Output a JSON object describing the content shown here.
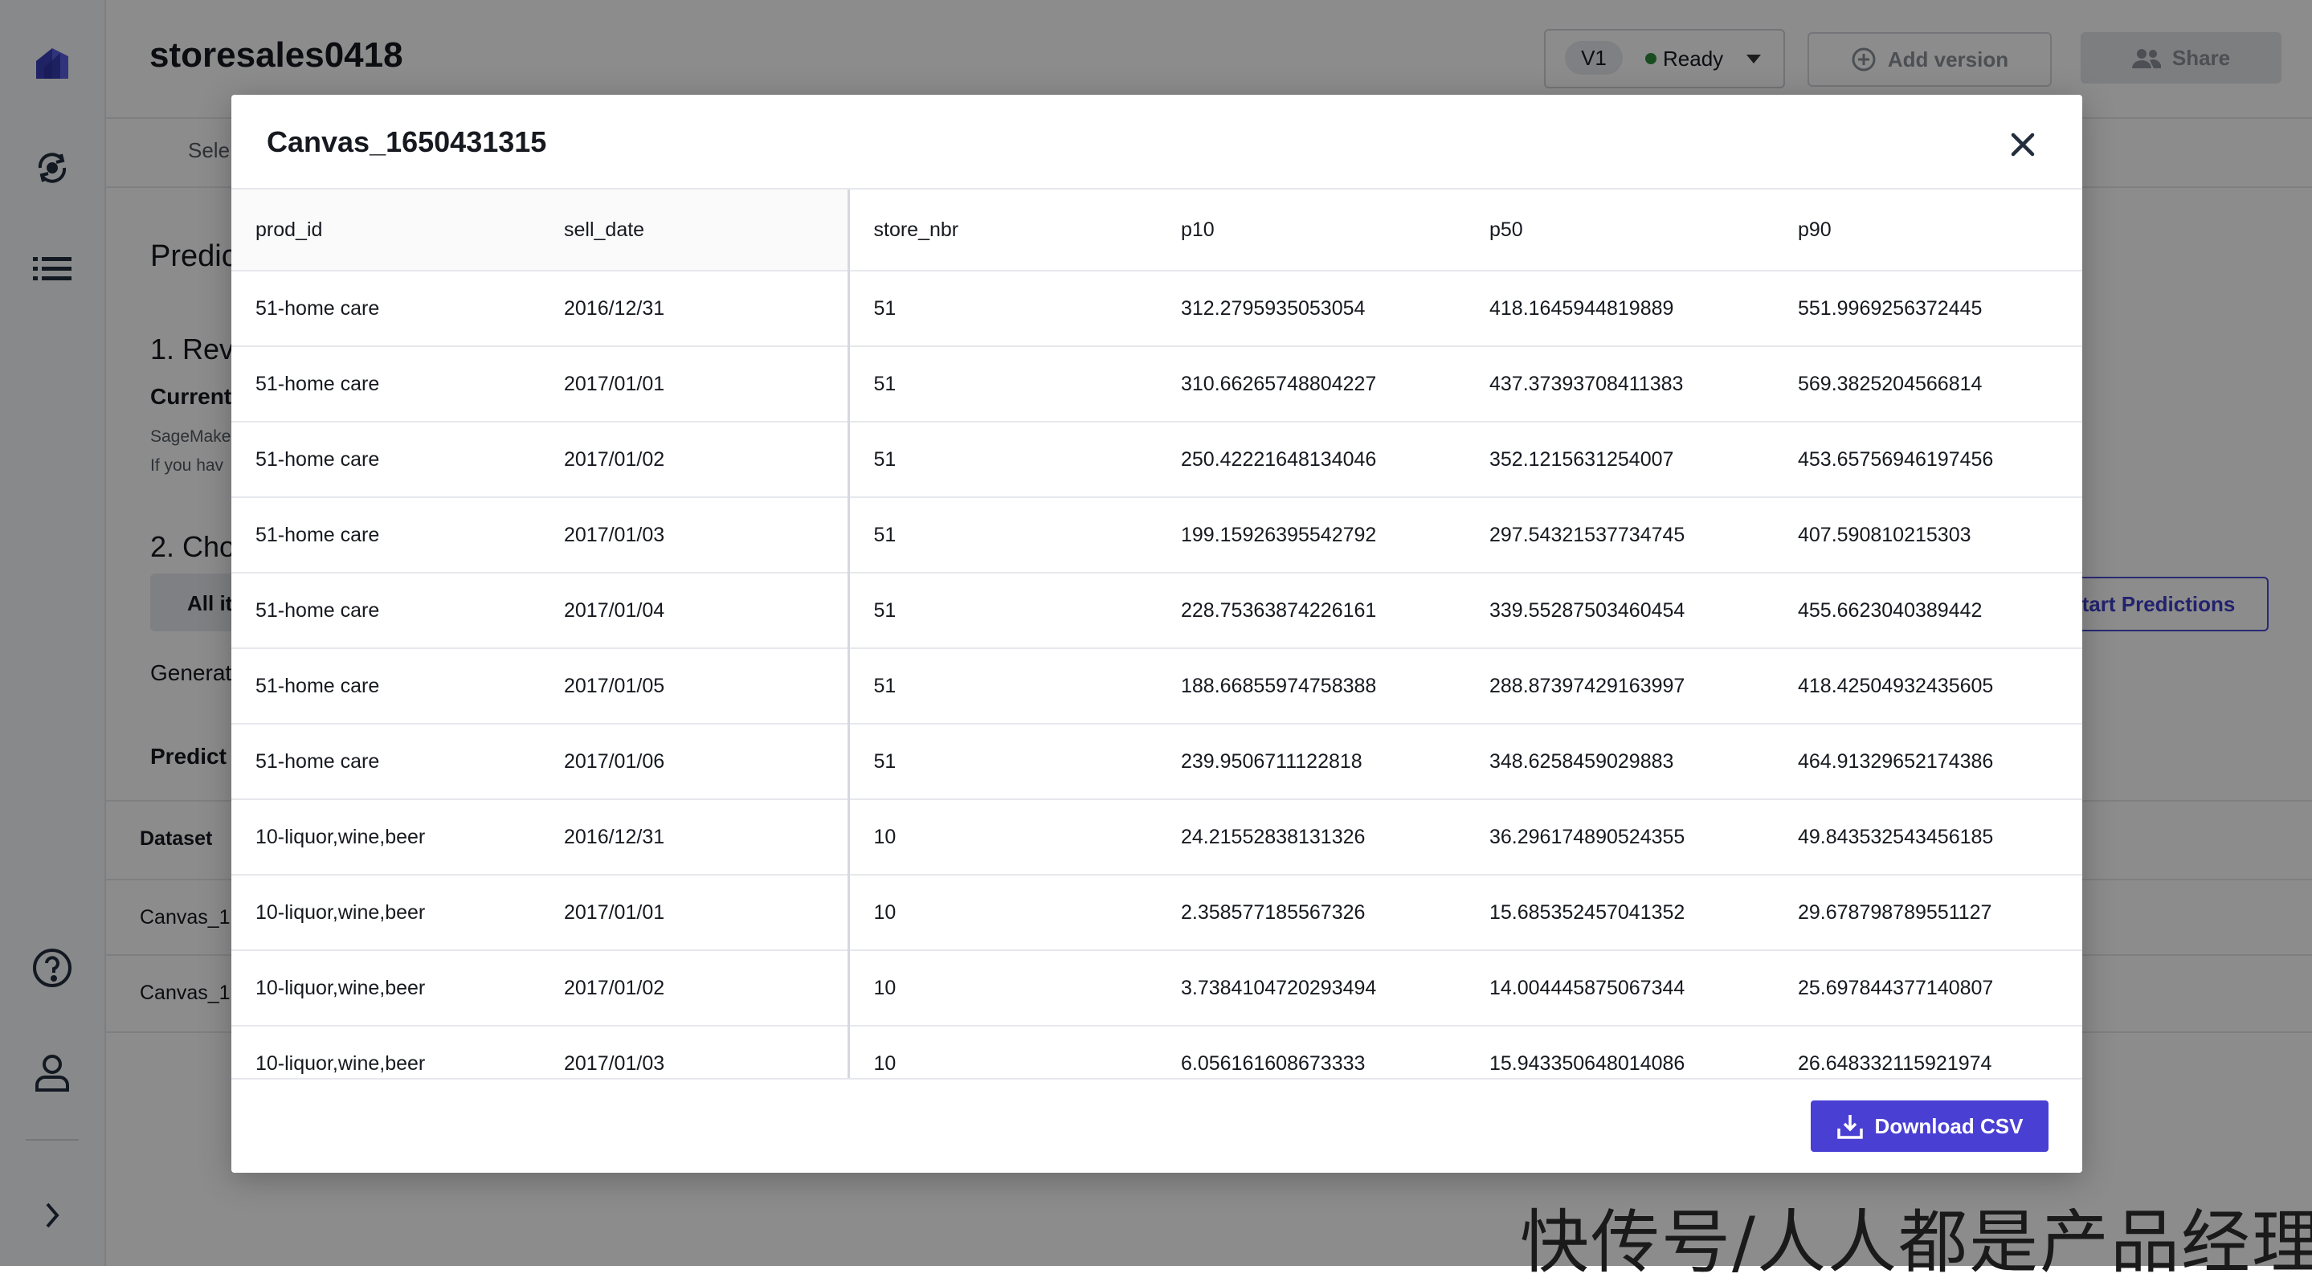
{
  "app": {
    "title": "storesales0418",
    "version": "V1",
    "status": "Ready",
    "add_version_label": "Add version",
    "share_label": "Share"
  },
  "background": {
    "tab_partial": "Sele",
    "heading_partial": "Predic",
    "section1_partial": "1. Revi",
    "current_partial": "Current",
    "sagemaker_partial": "SageMake",
    "ifyou_partial": "If you hav",
    "section2_partial": "2. Cho",
    "all_items_partial": "All it",
    "generate_partial": "Generat",
    "predict_partial": "Predict",
    "dataset_header": "Dataset",
    "canvas_row1": "Canvas_1",
    "canvas_row2": "Canvas_1",
    "start_predictions_partial": "tart Predictions"
  },
  "modal": {
    "title": "Canvas_1650431315",
    "download_label": "Download CSV",
    "columns": [
      "prod_id",
      "sell_date",
      "store_nbr",
      "p10",
      "p50",
      "p90"
    ],
    "rows": [
      [
        "51-home care",
        "2016/12/31",
        "51",
        "312.2795935053054",
        "418.1645944819889",
        "551.9969256372445"
      ],
      [
        "51-home care",
        "2017/01/01",
        "51",
        "310.66265748804227",
        "437.37393708411383",
        "569.3825204566814"
      ],
      [
        "51-home care",
        "2017/01/02",
        "51",
        "250.42221648134046",
        "352.1215631254007",
        "453.65756946197456"
      ],
      [
        "51-home care",
        "2017/01/03",
        "51",
        "199.15926395542792",
        "297.54321537734745",
        "407.590810215303"
      ],
      [
        "51-home care",
        "2017/01/04",
        "51",
        "228.75363874226161",
        "339.55287503460454",
        "455.6623040389442"
      ],
      [
        "51-home care",
        "2017/01/05",
        "51",
        "188.66855974758388",
        "288.87397429163997",
        "418.42504932435605"
      ],
      [
        "51-home care",
        "2017/01/06",
        "51",
        "239.9506711122818",
        "348.6258459029883",
        "464.91329652174386"
      ],
      [
        "10-liquor,wine,beer",
        "2016/12/31",
        "10",
        "24.21552838131326",
        "36.296174890524355",
        "49.843532543456185"
      ],
      [
        "10-liquor,wine,beer",
        "2017/01/01",
        "10",
        "2.358577185567326",
        "15.685352457041352",
        "29.678798789551127"
      ],
      [
        "10-liquor,wine,beer",
        "2017/01/02",
        "10",
        "3.7384104720293494",
        "14.004445875067344",
        "25.697844377140807"
      ],
      [
        "10-liquor,wine,beer",
        "2017/01/03",
        "10",
        "6.056161608673333",
        "15.943350648014086",
        "26.648332115921974"
      ]
    ]
  },
  "watermark": "快传号/人人都是产品经理"
}
